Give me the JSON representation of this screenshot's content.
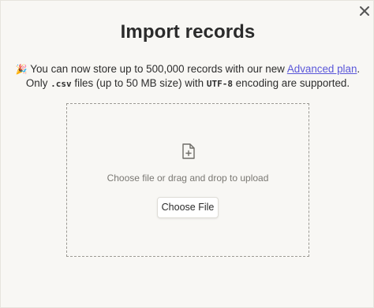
{
  "modal": {
    "title": "Import records",
    "close_icon": "close-icon"
  },
  "info": {
    "emoji": "🎉",
    "line1_text": " You can now store up to 500,000 records with our new ",
    "plan_link": "Advanced plan",
    "line1_end": ".",
    "line2_prefix": "Only ",
    "file_ext": ".csv",
    "line2_middle": " files (up to 50 MB size) with ",
    "encoding": "UTF-8",
    "line2_end": " encoding are supported."
  },
  "dropzone": {
    "icon": "file-add-icon",
    "instruction": "Choose file or drag and drop to upload",
    "button_label": "Choose File"
  },
  "colors": {
    "background": "#f8f7f4",
    "link": "#5a57d9",
    "muted_text": "#7a7873"
  }
}
